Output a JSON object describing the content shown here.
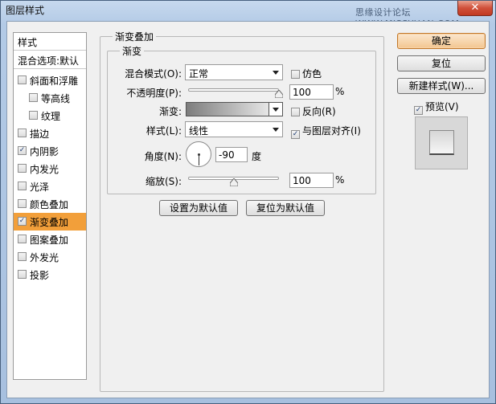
{
  "window": {
    "title": "图层样式",
    "watermark": "思缘设计论坛 WWW.MISSYUAN.COM",
    "close_glyph": "✕"
  },
  "stylelist": {
    "header": "样式",
    "blend": "混合选项:默认",
    "items": [
      {
        "label": "斜面和浮雕",
        "checked": false,
        "sub": false
      },
      {
        "label": "等高线",
        "checked": false,
        "sub": true
      },
      {
        "label": "纹理",
        "checked": false,
        "sub": true
      },
      {
        "label": "描边",
        "checked": false,
        "sub": false
      },
      {
        "label": "内阴影",
        "checked": true,
        "sub": false
      },
      {
        "label": "内发光",
        "checked": false,
        "sub": false
      },
      {
        "label": "光泽",
        "checked": false,
        "sub": false
      },
      {
        "label": "颜色叠加",
        "checked": false,
        "sub": false
      },
      {
        "label": "渐变叠加",
        "checked": true,
        "sub": false,
        "active": true
      },
      {
        "label": "图案叠加",
        "checked": false,
        "sub": false
      },
      {
        "label": "外发光",
        "checked": false,
        "sub": false
      },
      {
        "label": "投影",
        "checked": false,
        "sub": false
      }
    ]
  },
  "panel": {
    "outer_title": "渐变叠加",
    "inner_title": "渐变",
    "blend_mode_label": "混合模式(O):",
    "blend_mode_value": "正常",
    "dither_label": "仿色",
    "dither_checked": false,
    "opacity_label": "不透明度(P):",
    "opacity_value": "100",
    "opacity_fraction": 1.0,
    "percent": "%",
    "gradient_label": "渐变:",
    "reverse_label": "反向(R)",
    "reverse_checked": false,
    "style_label": "样式(L):",
    "style_value": "线性",
    "align_label": "与图层对齐(I)",
    "align_checked": true,
    "angle_label": "角度(N):",
    "angle_value": "-90",
    "angle_unit": "度",
    "scale_label": "缩放(S):",
    "scale_value": "100",
    "scale_fraction": 0.5,
    "set_default": "设置为默认值",
    "reset_default": "复位为默认值"
  },
  "side": {
    "ok": "确定",
    "reset": "复位",
    "new_style": "新建样式(W)...",
    "preview_label": "预览(V)",
    "preview_checked": true
  },
  "check_glyph": "✓",
  "colors": {
    "active_item": "#f29f3a",
    "default_button": "#f3c690"
  }
}
